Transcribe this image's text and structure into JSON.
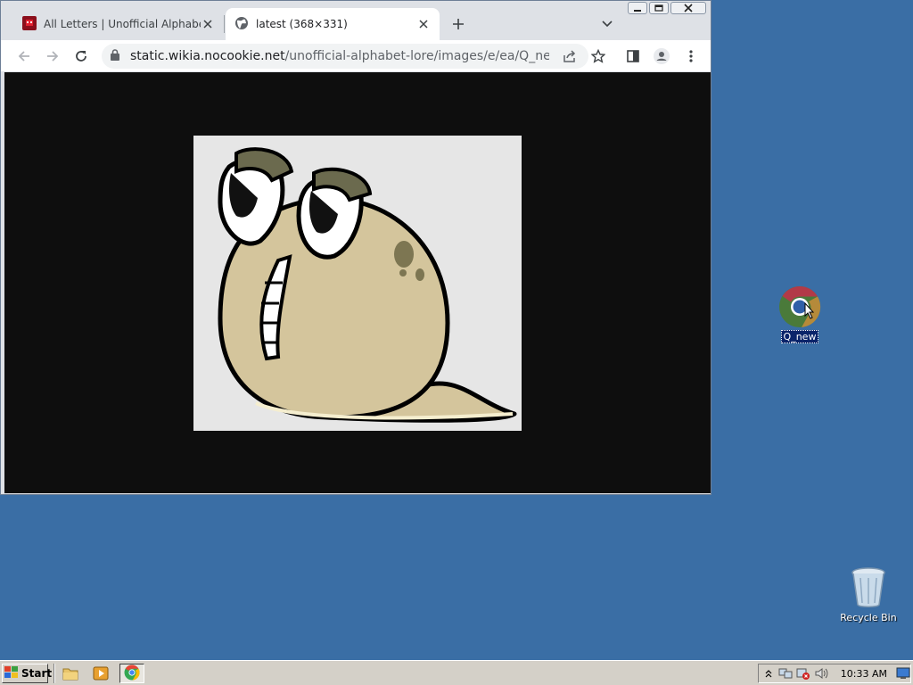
{
  "browser": {
    "tabs": [
      {
        "title": "All Letters | Unofficial Alphabet Lore",
        "active": false,
        "icon": "wiki-favicon-icon"
      },
      {
        "title": "latest (368×331)",
        "active": true,
        "icon": "globe-icon"
      }
    ],
    "url_host": "static.wikia.nocookie.net",
    "url_path": "/unofficial-alphabet-lore/images/e/ea/Q_new.png/...",
    "accent_color": "#dee1e6",
    "viewport_background": "#0e0e0e"
  },
  "desktop": {
    "background": "#3a6ea5",
    "icons": [
      {
        "label": "Q_new",
        "icon": "chrome-icon",
        "selected": true
      },
      {
        "label": "Recycle Bin",
        "icon": "recycle-bin-icon"
      }
    ]
  },
  "taskbar": {
    "start_label": "Start",
    "clock": "10:33 AM"
  }
}
